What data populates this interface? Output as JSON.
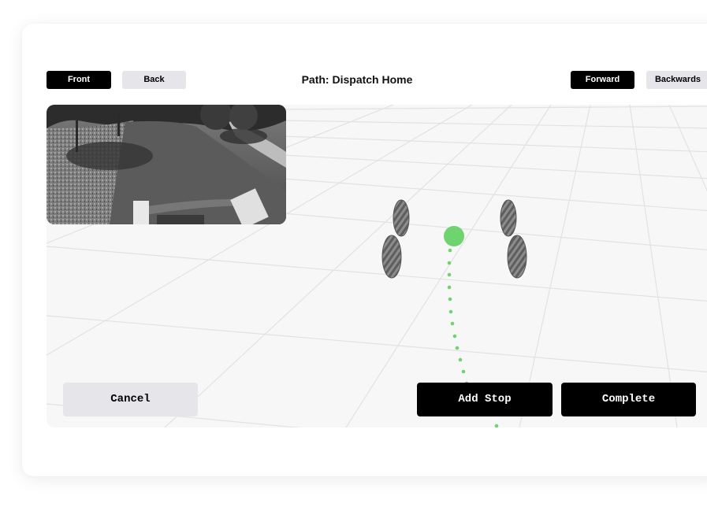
{
  "camera_toggle": {
    "front_label": "Front",
    "back_label": "Back",
    "selected": "Front"
  },
  "header": {
    "title": "Path: Dispatch Home"
  },
  "direction_toggle": {
    "forward_label": "Forward",
    "backwards_label": "Backwards",
    "selected": "Forward"
  },
  "actions": {
    "cancel_label": "Cancel",
    "add_stop_label": "Add Stop",
    "complete_label": "Complete"
  },
  "colors": {
    "primary": "#000000",
    "secondary": "#e6e6ea",
    "path_accent": "#6fd36f",
    "viewport_bg": "#f7f7f7"
  }
}
